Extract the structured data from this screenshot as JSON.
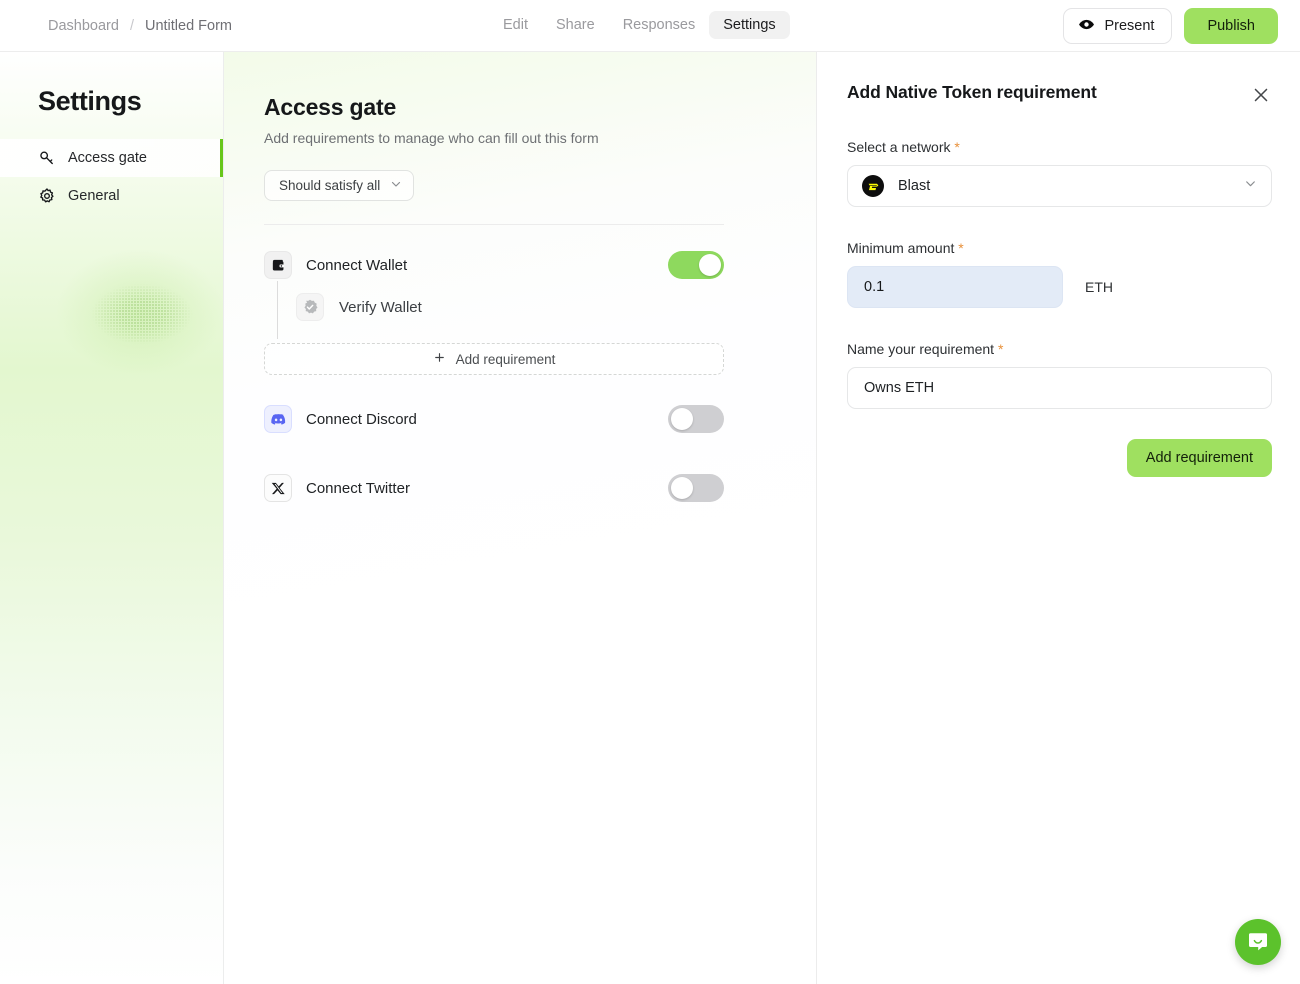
{
  "topbar": {
    "breadcrumb": {
      "dashboard": "Dashboard",
      "separator": "/",
      "form_name": "Untitled Form"
    },
    "tabs": [
      {
        "label": "Edit",
        "active": false
      },
      {
        "label": "Share",
        "active": false
      },
      {
        "label": "Responses",
        "active": false
      },
      {
        "label": "Settings",
        "active": true
      }
    ],
    "present_label": "Present",
    "publish_label": "Publish"
  },
  "sidebar": {
    "title": "Settings",
    "items": [
      {
        "label": "Access gate",
        "icon": "key-icon",
        "active": true
      },
      {
        "label": "General",
        "icon": "gear-icon",
        "active": false
      }
    ],
    "active_accent": "#67C61A"
  },
  "main": {
    "title": "Access gate",
    "subtitle": "Add requirements to manage who can fill out this form",
    "satisfy_select": {
      "value": "Should satisfy all",
      "caret": "chevron-down-icon"
    },
    "requirements": [
      {
        "label": "Connect Wallet",
        "icon": "wallet-icon",
        "toggle_on": true
      },
      {
        "label": "Connect Discord",
        "icon": "discord-icon",
        "toggle_on": false
      },
      {
        "label": "Connect Twitter",
        "icon": "twitter-x-icon",
        "toggle_on": false
      }
    ],
    "sub_requirement": {
      "label": "Verify Wallet",
      "icon": "check-badge-icon"
    },
    "add_requirement_label": "Add requirement",
    "add_requirement_icon": "plus-icon"
  },
  "panel": {
    "title": "Add Native Token requirement",
    "close_icon": "close-icon",
    "network_label": "Select a network",
    "network_value": "Blast",
    "network_icon": "blast-icon",
    "amount_label": "Minimum amount",
    "amount_value": "0.1",
    "amount_placeholder": "0.0",
    "amount_unit": "ETH",
    "name_label": "Name your requirement",
    "name_value": "Owns ETH",
    "name_placeholder": "Requirement name",
    "submit_label": "Add requirement",
    "required_marker": "*"
  },
  "chat": {
    "icon": "chat-bubble-icon"
  },
  "colors": {
    "brand_green": "#9FE060",
    "toggle_green": "#8ED95E",
    "accent_bar": "#67C61A",
    "required_star": "#E8903A",
    "chat_green": "#5CC22C",
    "discord_blue": "#5865F2",
    "blast_yellow": "#FCFC03"
  }
}
